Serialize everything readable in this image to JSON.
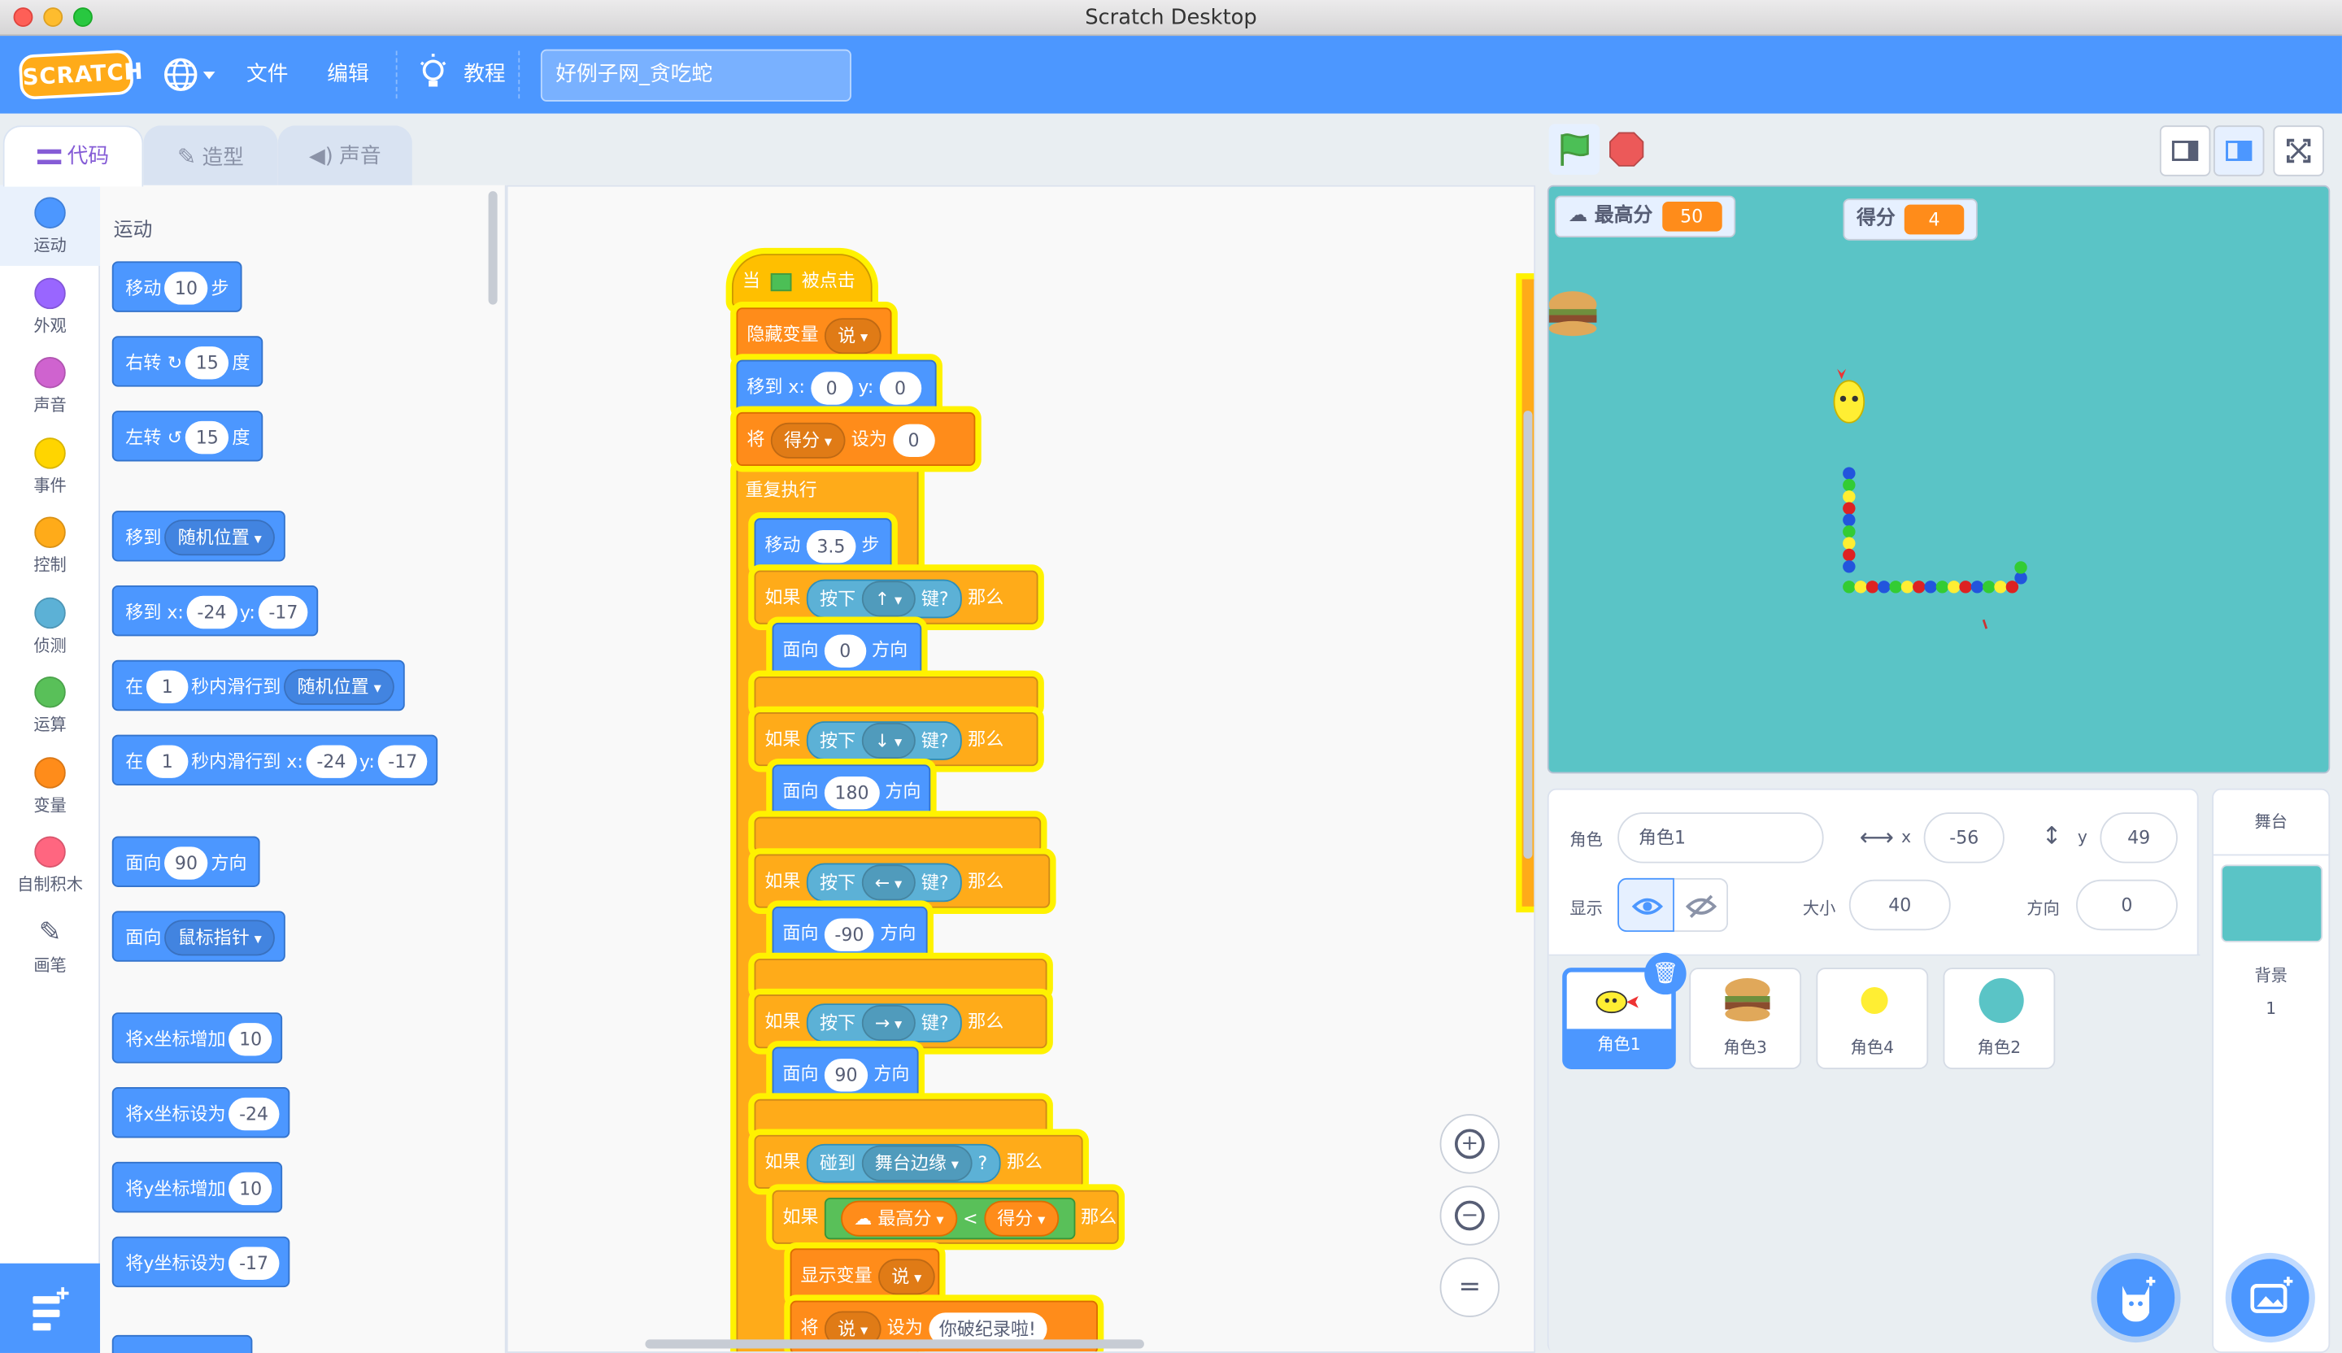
{
  "window": {
    "title": "Scratch Desktop"
  },
  "menubar": {
    "logo": "SCRATCH",
    "language_icon": "globe-icon",
    "file": "文件",
    "edit": "编辑",
    "tutorials": "教程",
    "project_name": "好例子网_贪吃蛇"
  },
  "tabs": {
    "code": "代码",
    "costumes": "造型",
    "sounds": "声音"
  },
  "categories": [
    {
      "label": "运动",
      "color": "#4c97ff"
    },
    {
      "label": "外观",
      "color": "#9966ff"
    },
    {
      "label": "声音",
      "color": "#cf63cf"
    },
    {
      "label": "事件",
      "color": "#ffd500"
    },
    {
      "label": "控制",
      "color": "#ffab19"
    },
    {
      "label": "侦测",
      "color": "#5cb1d6"
    },
    {
      "label": "运算",
      "color": "#59c059"
    },
    {
      "label": "变量",
      "color": "#ff8c1a"
    },
    {
      "label": "自制积木",
      "color": "#ff6680"
    },
    {
      "label": "画笔",
      "color": "#0fbd8c"
    }
  ],
  "palette": {
    "heading": "运动",
    "move": {
      "a": "移动",
      "v": "10",
      "b": "步"
    },
    "turn_right": {
      "a": "右转",
      "v": "15",
      "b": "度"
    },
    "turn_left": {
      "a": "左转",
      "v": "15",
      "b": "度"
    },
    "goto": {
      "a": "移到",
      "dd": "随机位置"
    },
    "goto_xy": {
      "a": "移到 x:",
      "x": "-24",
      "yl": "y:",
      "y": "-17"
    },
    "glide_to": {
      "a": "在",
      "v": "1",
      "b": "秒内滑行到",
      "dd": "随机位置"
    },
    "glide_xy": {
      "a": "在",
      "v": "1",
      "b": "秒内滑行到 x:",
      "x": "-24",
      "yl": "y:",
      "y": "-17"
    },
    "point_dir": {
      "a": "面向",
      "v": "90",
      "b": "方向"
    },
    "point_towards": {
      "a": "面向",
      "dd": "鼠标指针"
    },
    "change_x": {
      "a": "将x坐标增加",
      "v": "10"
    },
    "set_x": {
      "a": "将x坐标设为",
      "v": "-24"
    },
    "change_y": {
      "a": "将y坐标增加",
      "v": "10"
    },
    "set_y": {
      "a": "将y坐标设为",
      "v": "-17"
    }
  },
  "script": {
    "hat": {
      "a": "当",
      "b": "被点击"
    },
    "hide_var": {
      "a": "隐藏变量",
      "dd": "说"
    },
    "goto": {
      "a": "移到 x:",
      "x": "0",
      "yl": "y:",
      "y": "0"
    },
    "set_var": {
      "a": "将",
      "dd": "得分",
      "b": "设为",
      "v": "0"
    },
    "forever": "重复执行",
    "move": {
      "a": "移动",
      "v": "3.5",
      "b": "步"
    },
    "if_word": "如果",
    "then_word": "那么",
    "key_press": "按下",
    "key_q": "键?",
    "face": "面向",
    "dir_word": "方向",
    "keys": [
      {
        "key": "↑",
        "dir": "0"
      },
      {
        "key": "↓",
        "dir": "180"
      },
      {
        "key": "←",
        "dir": "-90"
      },
      {
        "key": "→",
        "dir": "90"
      }
    ],
    "touch": {
      "a": "碰到",
      "dd": "舞台边缘",
      "q": "?"
    },
    "compare": {
      "l": "最高分",
      "op": "<",
      "r": "得分"
    },
    "show_var": {
      "a": "显示变量",
      "dd": "说"
    },
    "set_say": {
      "a": "将",
      "dd": "说",
      "b": "设为",
      "v": "你破纪录啦!"
    }
  },
  "zoom": {
    "in": "+",
    "out": "−",
    "reset": "="
  },
  "stage": {
    "monitors": [
      {
        "label": "最高分",
        "value": "50"
      },
      {
        "label": "得分",
        "value": "4"
      }
    ]
  },
  "sprite_info": {
    "sprite_label": "角色",
    "sprite_name": "角色1",
    "x_label": "x",
    "x": "-56",
    "y_label": "y",
    "y": "49",
    "show_label": "显示",
    "size_label": "大小",
    "size": "40",
    "direction_label": "方向",
    "direction": "0"
  },
  "sprites": [
    {
      "name": "角色1",
      "selected": true
    },
    {
      "name": "角色3"
    },
    {
      "name": "角色4"
    },
    {
      "name": "角色2"
    }
  ],
  "stage_pane": {
    "title": "舞台",
    "backdrops_label": "背景",
    "backdrops_count": "1"
  },
  "colors": {
    "menu": "#4c97ff",
    "stage_bg": "#5ac4c6",
    "selected": "#4c97ff"
  }
}
